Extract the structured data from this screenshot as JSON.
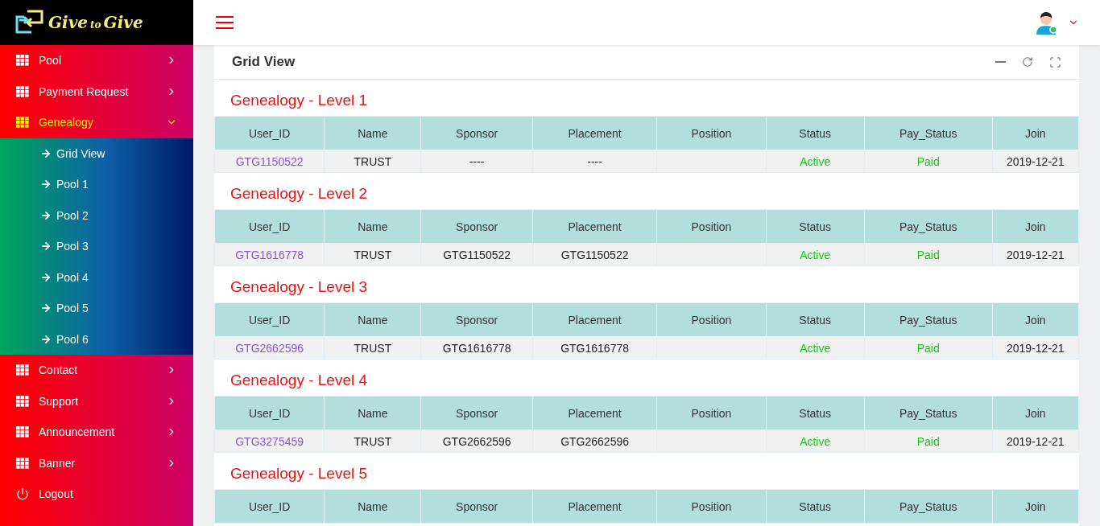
{
  "logo": {
    "first": "Give",
    "middle": "to",
    "last": "Give"
  },
  "sidebar": {
    "items": [
      {
        "kind": "menu",
        "label": "Pool",
        "selected": false,
        "expanded": false
      },
      {
        "kind": "menu",
        "label": "Payment Request",
        "selected": false,
        "expanded": false
      },
      {
        "kind": "menu",
        "label": "Genealogy",
        "selected": true,
        "expanded": true,
        "children": [
          {
            "label": "Grid View"
          },
          {
            "label": "Pool 1"
          },
          {
            "label": "Pool 2"
          },
          {
            "label": "Pool 3"
          },
          {
            "label": "Pool 4"
          },
          {
            "label": "Pool 5"
          },
          {
            "label": "Pool 6"
          }
        ]
      },
      {
        "kind": "menu",
        "label": "Contact",
        "selected": false,
        "expanded": false
      },
      {
        "kind": "menu",
        "label": "Support",
        "selected": false,
        "expanded": false
      },
      {
        "kind": "menu",
        "label": "Announcement",
        "selected": false,
        "expanded": false
      },
      {
        "kind": "menu",
        "label": "Banner",
        "selected": false,
        "expanded": false
      },
      {
        "kind": "logout",
        "label": "Logout"
      }
    ]
  },
  "card": {
    "title": "Grid View"
  },
  "levels": [
    {
      "title": "Genealogy - Level 1",
      "columns": [
        "User_ID",
        "Name",
        "Sponsor",
        "Placement",
        "Position",
        "Status",
        "Pay_Status",
        "Join"
      ],
      "rows": [
        {
          "user_id": "GTG1150522",
          "name": "TRUST",
          "sponsor": "----",
          "placement": "----",
          "status": "Active",
          "pay_status": "Paid",
          "join": "2019-12-21"
        }
      ]
    },
    {
      "title": "Genealogy - Level 2",
      "columns": [
        "User_ID",
        "Name",
        "Sponsor",
        "Placement",
        "Position",
        "Status",
        "Pay_Status",
        "Join"
      ],
      "rows": [
        {
          "user_id": "GTG1616778",
          "name": "TRUST",
          "sponsor": "GTG1150522",
          "placement": "GTG1150522",
          "status": "Active",
          "pay_status": "Paid",
          "join": "2019-12-21"
        }
      ]
    },
    {
      "title": "Genealogy - Level 3",
      "columns": [
        "User_ID",
        "Name",
        "Sponsor",
        "Placement",
        "Position",
        "Status",
        "Pay_Status",
        "Join"
      ],
      "rows": [
        {
          "user_id": "GTG2662596",
          "name": "TRUST",
          "sponsor": "GTG1616778",
          "placement": "GTG1616778",
          "status": "Active",
          "pay_status": "Paid",
          "join": "2019-12-21"
        }
      ]
    },
    {
      "title": "Genealogy - Level 4",
      "columns": [
        "User_ID",
        "Name",
        "Sponsor",
        "Placement",
        "Position",
        "Status",
        "Pay_Status",
        "Join"
      ],
      "rows": [
        {
          "user_id": "GTG3275459",
          "name": "TRUST",
          "sponsor": "GTG2662596",
          "placement": "GTG2662596",
          "status": "Active",
          "pay_status": "Paid",
          "join": "2019-12-21"
        }
      ]
    },
    {
      "title": "Genealogy - Level 5",
      "columns": [
        "User_ID",
        "Name",
        "Sponsor",
        "Placement",
        "Position",
        "Status",
        "Pay_Status",
        "Join"
      ]
    }
  ]
}
